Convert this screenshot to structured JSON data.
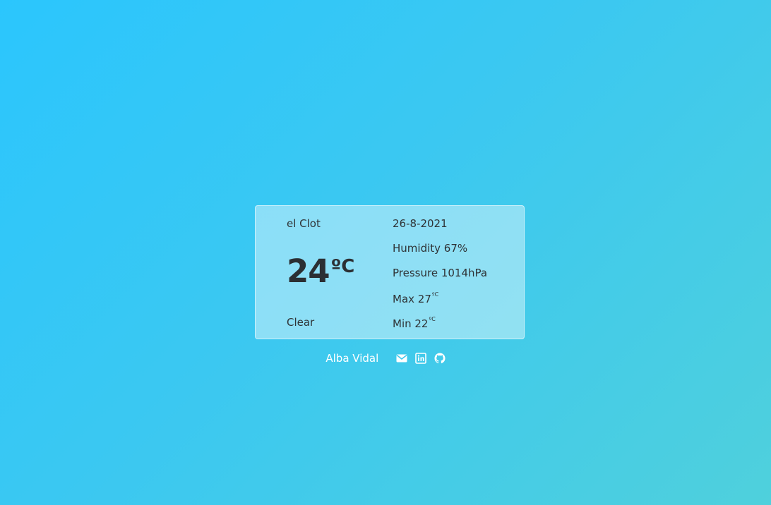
{
  "weather": {
    "city": "el Clot",
    "temperature": "24",
    "temperature_unit": "ºC",
    "description": "Clear",
    "date": "26-8-2021",
    "humidity_label": "Humidity 67%",
    "pressure_label": "Pressure 1014hPa",
    "max_label": "Max 27",
    "max_unit": "ºC",
    "min_label": "Min 22",
    "min_unit": "ºC"
  },
  "footer": {
    "author": "Alba Vidal",
    "icons": [
      "envelope-icon",
      "linkedin-icon",
      "github-icon"
    ]
  },
  "colors": {
    "background_start": "#2bc6fd",
    "background_end": "#4fd0dc",
    "card_background": "rgba(255,255,255,0.42)",
    "text": "#2f3336",
    "footer_text": "#ffffff"
  }
}
